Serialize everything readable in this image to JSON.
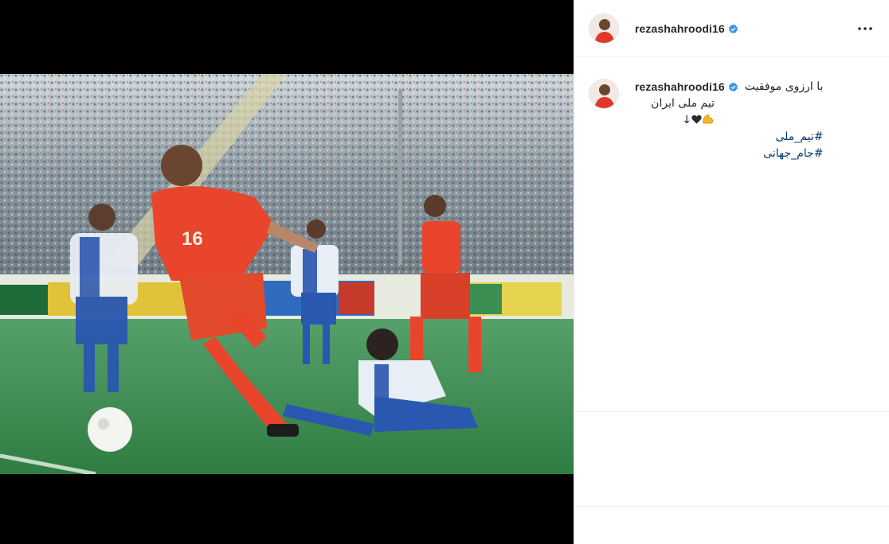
{
  "post": {
    "username": "rezashahroodi16",
    "caption_line1": "با ارزوی موفقیت",
    "caption_line2_text": "تیم ملی ایران",
    "caption_line2_prefix": "↓",
    "hashtags": [
      "#تیم_ملی",
      "#جام_جهانی"
    ],
    "more_label": "•••"
  },
  "colors": {
    "hashtag": "#00376b",
    "verified": "#3897f0",
    "text": "#262626",
    "jersey_red": "#e8452c",
    "pitch_green": "#3c8f52"
  },
  "icons": {
    "verified": "verified-badge-icon",
    "more": "more-options-icon",
    "muscle": "flexed-biceps-emoji",
    "heart": "black-heart-emoji"
  }
}
